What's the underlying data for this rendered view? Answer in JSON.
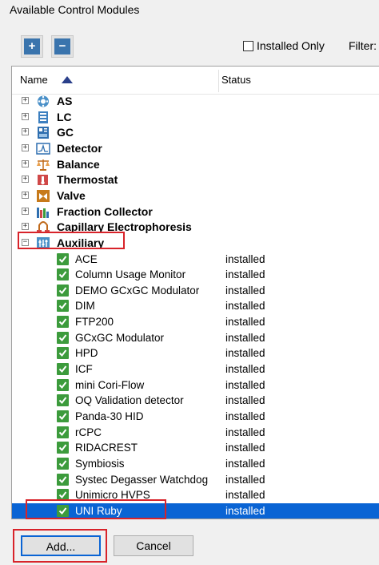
{
  "window": {
    "title": "Available Control Modules"
  },
  "toolbar": {
    "expand_icon": "plus-icon",
    "collapse_icon": "minus-icon",
    "expand_glyph": "+",
    "collapse_glyph": "−",
    "installed_only_label": "Installed Only",
    "installed_only_checked": false,
    "filter_label": "Filter:"
  },
  "columns": {
    "name": "Name",
    "status": "Status",
    "sort": "ascending"
  },
  "categories": [
    {
      "label": "AS",
      "icon": "autosampler-icon",
      "expander": "+"
    },
    {
      "label": "LC",
      "icon": "lc-icon",
      "expander": "+"
    },
    {
      "label": "GC",
      "icon": "gc-icon",
      "expander": "+"
    },
    {
      "label": "Detector",
      "icon": "detector-icon",
      "expander": "+"
    },
    {
      "label": "Balance",
      "icon": "balance-icon",
      "expander": "+"
    },
    {
      "label": "Thermostat",
      "icon": "thermostat-icon",
      "expander": "+"
    },
    {
      "label": "Valve",
      "icon": "valve-icon",
      "expander": "+"
    },
    {
      "label": "Fraction Collector",
      "icon": "fraction-collector-icon",
      "expander": "+"
    },
    {
      "label": "Capillary Electrophoresis",
      "icon": "capillary-electrophoresis-icon",
      "expander": "+"
    },
    {
      "label": "Auxiliary",
      "icon": "auxiliary-icon",
      "expander": "−"
    }
  ],
  "auxiliary_items": [
    {
      "label": "ACE",
      "status": "installed"
    },
    {
      "label": "Column Usage Monitor",
      "status": "installed"
    },
    {
      "label": "DEMO GCxGC Modulator",
      "status": "installed"
    },
    {
      "label": "DIM",
      "status": "installed"
    },
    {
      "label": "FTP200",
      "status": "installed"
    },
    {
      "label": "GCxGC Modulator",
      "status": "installed"
    },
    {
      "label": "HPD",
      "status": "installed"
    },
    {
      "label": "ICF",
      "status": "installed"
    },
    {
      "label": "mini Cori-Flow",
      "status": "installed"
    },
    {
      "label": "OQ Validation detector",
      "status": "installed"
    },
    {
      "label": "Panda-30 HID",
      "status": "installed"
    },
    {
      "label": "rCPC",
      "status": "installed"
    },
    {
      "label": "RIDACREST",
      "status": "installed"
    },
    {
      "label": "Symbiosis",
      "status": "installed"
    },
    {
      "label": "Systec Degasser Watchdog",
      "status": "installed"
    },
    {
      "label": "Unimicro HVPS",
      "status": "installed"
    },
    {
      "label": "UNI Ruby",
      "status": "installed",
      "selected": true
    }
  ],
  "buttons": {
    "add": "Add...",
    "cancel": "Cancel"
  },
  "colors": {
    "selection": "#0a64d4",
    "highlight": "#d8232a",
    "check": "#3c9b3c"
  }
}
